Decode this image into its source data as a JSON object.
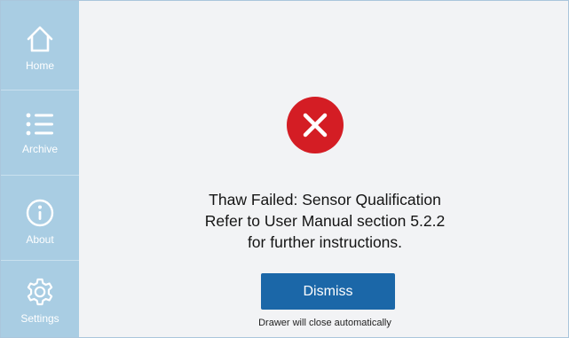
{
  "sidebar": {
    "items": [
      {
        "label": "Home",
        "icon": "home-icon"
      },
      {
        "label": "Archive",
        "icon": "list-icon"
      },
      {
        "label": "About",
        "icon": "info-icon"
      },
      {
        "label": "Settings",
        "icon": "gear-icon"
      }
    ]
  },
  "dialog": {
    "status_icon": "error-x-icon",
    "lines": [
      "Thaw Failed: Sensor Qualification",
      "Refer to User Manual section 5.2.2",
      "for further instructions."
    ],
    "dismiss_label": "Dismiss",
    "note": "Drawer will close automatically"
  },
  "colors": {
    "sidebar_bg": "#a9cde3",
    "error": "#d41d24",
    "primary_button": "#1b67a8",
    "background": "#f2f3f5"
  }
}
